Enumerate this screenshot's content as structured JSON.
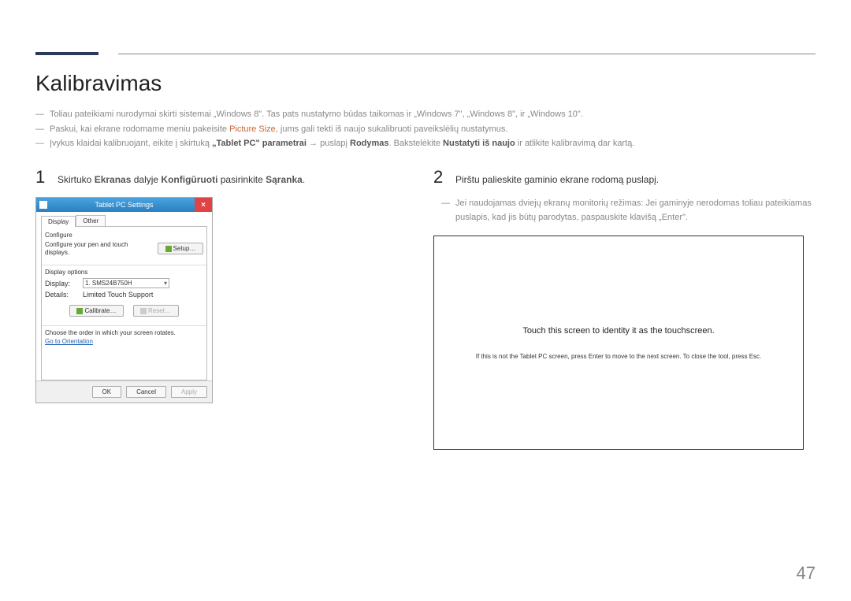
{
  "section_title": "Kalibravimas",
  "notes": {
    "n1_pre": "Toliau pateikiami nurodymai skirti sistemai „Windows 8\". Tas pats nustatymo būdas taikomas ir „Windows 7\", „Windows 8\", ir „Windows 10\".",
    "n2_pre": "Paskui, kai ekrane rodomame meniu pakeisite ",
    "n2_hl": "Picture Size",
    "n2_post": ", jums gali tekti iš naujo sukalibruoti paveikslėlių nustatymus.",
    "n3_pre": "Įvykus klaidai kalibruojant, eikite į skirtuką ",
    "n3_b1": "„Tablet PC\" parametrai",
    "n3_arrow": " → ",
    "n3_mid": " puslapį ",
    "n3_b2": "Rodymas",
    "n3_mid2": ". Bakstelėkite ",
    "n3_b3": "Nustatyti iš naujo",
    "n3_post": " ir atlikite kalibravimą dar kartą."
  },
  "step1": {
    "num": "1",
    "t1": "Skirtuko ",
    "b1": "Ekranas",
    "t2": " dalyje ",
    "b2": "Konfigūruoti",
    "t3": " pasirinkite ",
    "b3": "Sąranka",
    "t4": "."
  },
  "step2": {
    "num": "2",
    "text": "Pirštu palieskite gaminio ekrane rodomą puslapį.",
    "subnote": "Jei naudojamas dviejų ekranų monitorių režimas: Jei gaminyje nerodomas toliau pateikiamas puslapis, kad jis būtų parodytas, paspauskite klavišą „Enter\"."
  },
  "dialog": {
    "title": "Tablet PC Settings",
    "close": "×",
    "tab_display": "Display",
    "tab_other": "Other",
    "configure_hdr": "Configure",
    "configure_text": "Configure your pen and touch displays.",
    "setup_btn": "Setup…",
    "display_options_hdr": "Display options",
    "display_lbl": "Display:",
    "display_val": "1. SMS24B750H",
    "details_lbl": "Details:",
    "details_val": "Limited Touch Support",
    "calibrate_btn": "Calibrate…",
    "reset_btn": "Reset…",
    "order_text": "Choose the order in which your screen rotates.",
    "orient_link": "Go to Orientation",
    "ok": "OK",
    "cancel": "Cancel",
    "apply": "Apply"
  },
  "touch": {
    "main": "Touch this screen to identity it as the touchscreen.",
    "sub": "If this is not the Tablet PC screen, press Enter to move to the next screen. To close the tool, press Esc."
  },
  "page_number": "47"
}
